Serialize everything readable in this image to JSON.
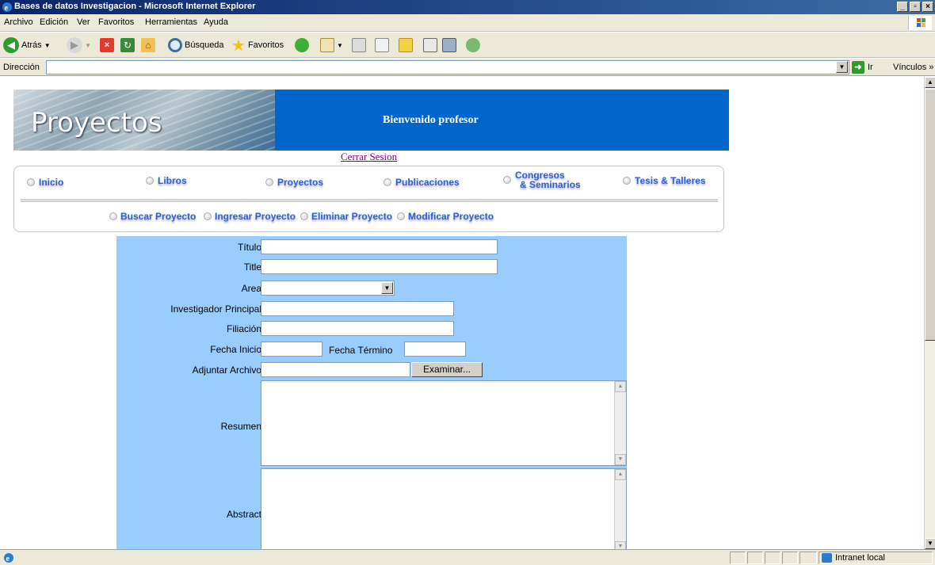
{
  "window": {
    "title": "Bases de datos Investigacion - Microsoft Internet Explorer"
  },
  "menu": {
    "items": [
      "Archivo",
      "Edición",
      "Ver",
      "Favoritos",
      "Herramientas",
      "Ayuda"
    ]
  },
  "toolbar": {
    "back_label": "Atrás",
    "search_label": "Búsqueda",
    "favorites_label": "Favoritos"
  },
  "address": {
    "label": "Dirección",
    "value": "",
    "go_label": "Ir",
    "links_label": "Vínculos"
  },
  "banner": {
    "title": "Proyectos",
    "welcome": "Bienvenido profesor"
  },
  "session": {
    "logout_label": "Cerrar Sesion"
  },
  "nav": {
    "items": [
      "Inicio",
      "Libros",
      "Proyectos",
      "Publicaciones",
      "Congresos",
      "& Seminarios",
      "Tesis & Talleres"
    ],
    "sub_items": [
      "Buscar Proyecto",
      "Ingresar Proyecto",
      "Eliminar Proyecto",
      "Modificar Proyecto"
    ]
  },
  "form": {
    "titulo_label": "Título",
    "title_label": "Title",
    "area_label": "Area",
    "investigador_label": "Investigador Principal",
    "filiacion_label": "Filiación",
    "fecha_inicio_label": "Fecha Inicio",
    "fecha_termino_label": "Fecha Término",
    "adjuntar_label": "Adjuntar Archivo",
    "browse_label": "Examinar...",
    "resumen_label": "Resumen",
    "abstract_label": "Abstract"
  },
  "status": {
    "zone_label": "Intranet local"
  },
  "colors": {
    "banner_bg": "#0066cc",
    "form_bg": "#99ccff",
    "nav_text": "#2f5fd0",
    "link_visited": "#800080"
  }
}
